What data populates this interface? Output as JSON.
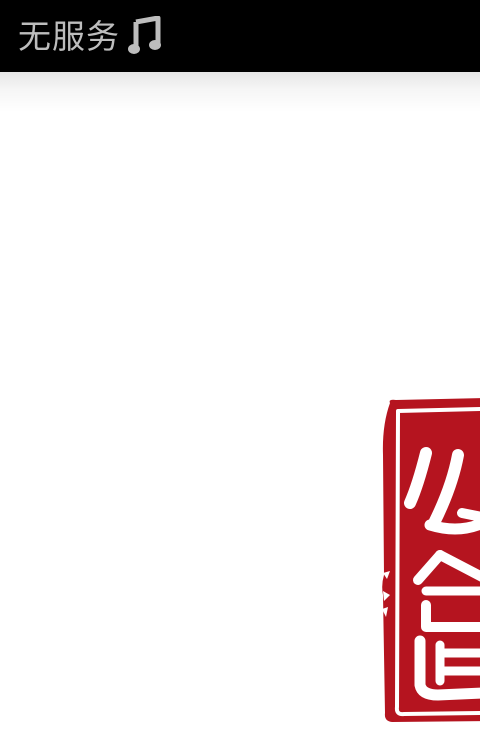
{
  "status_bar": {
    "carrier_text": "无服务",
    "notification_icon": "music-note-icon"
  },
  "splash": {
    "seal_logo": "red-seal-stamp",
    "seal_chars": [
      "公",
      "倉"
    ]
  },
  "colors": {
    "status_bar_bg": "#000000",
    "status_text": "#bdbdbd",
    "seal_red": "#b5141f",
    "background": "#ffffff"
  }
}
